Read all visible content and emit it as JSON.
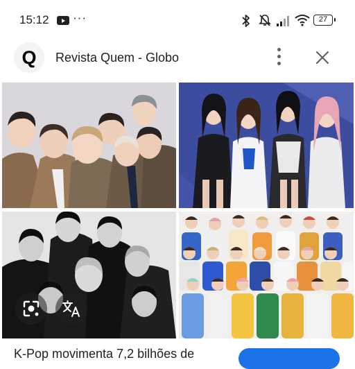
{
  "status_bar": {
    "time": "15:12",
    "battery": "27",
    "icons": [
      "youtube-icon",
      "more-dots-icon",
      "bluetooth-icon",
      "mute-icon",
      "signal-icon",
      "wifi-icon",
      "battery-icon"
    ],
    "more": "···"
  },
  "header": {
    "logo_letter": "Q",
    "title": "Revista Quem - Globo",
    "icons": [
      "more-vert-icon",
      "close-icon"
    ]
  },
  "images": [
    {
      "name": "group-photo-boy-band"
    },
    {
      "name": "group-photo-girl-group"
    },
    {
      "name": "group-photo-monochrome"
    },
    {
      "name": "group-photo-large-group"
    }
  ],
  "overlay_buttons": {
    "icons": [
      "lens-icon",
      "translate-icon"
    ]
  },
  "caption": {
    "text": "K-Pop movimenta 7,2 bilhões de"
  },
  "colors": {
    "accent": "#1a73e8",
    "text": "#202124",
    "icon": "#5f6368"
  }
}
